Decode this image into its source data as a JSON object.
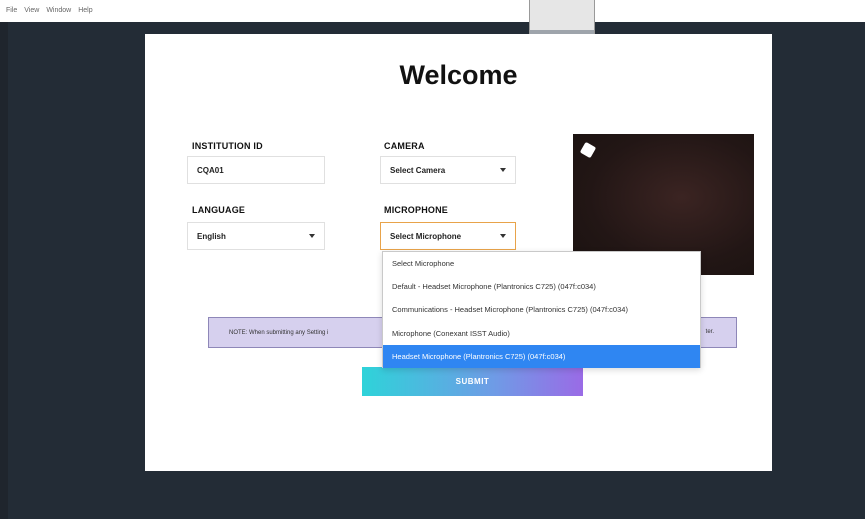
{
  "menubar": {
    "items": [
      "File",
      "View",
      "Window",
      "Help"
    ]
  },
  "page": {
    "title": "Welcome"
  },
  "form": {
    "institution": {
      "label": "INSTITUTION ID",
      "value": "CQA01"
    },
    "camera": {
      "label": "CAMERA",
      "value": "Select Camera"
    },
    "language": {
      "label": "LANGUAGE",
      "value": "English"
    },
    "microphone": {
      "label": "MICROPHONE",
      "value": "Select Microphone"
    }
  },
  "microphone_dropdown": {
    "options": [
      "Select Microphone",
      "Default - Headset Microphone (Plantronics C725) (047f:c034)",
      "Communications - Headset Microphone (Plantronics C725) (047f:c034)",
      "Microphone (Conexant ISST Audio)",
      "Headset Microphone (Plantronics C725) (047f:c034)"
    ],
    "highlighted_index": 4
  },
  "note": {
    "text": "NOTE: When submitting any Setting i",
    "tail": "ter."
  },
  "submit": {
    "label": "SUBMIT"
  },
  "colors": {
    "accent": "#2f86f2",
    "focus": "#e8a34a",
    "note_bg": "#d6d0ee",
    "background": "#232c36"
  }
}
